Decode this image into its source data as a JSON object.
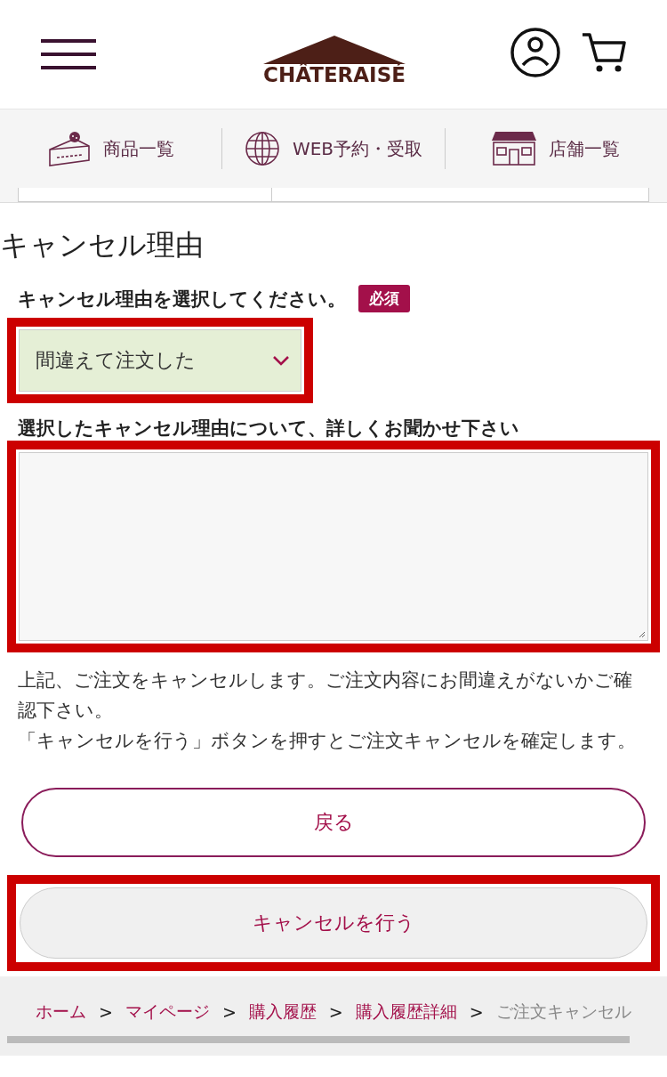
{
  "header": {
    "logo": "CHÂTERAISÉ"
  },
  "nav": [
    {
      "kind": "cake",
      "label": "商品一覧"
    },
    {
      "kind": "globe",
      "label": "WEB予約・受取"
    },
    {
      "kind": "store",
      "label": "店舗一覧"
    }
  ],
  "section_title": "キャンセル理由",
  "reason": {
    "label": "キャンセル理由を選択してください。",
    "badge": "必須",
    "value": "間違えて注文した",
    "highlighted": true
  },
  "details": {
    "label": "選択したキャンセル理由について、詳しくお聞かせ下さい",
    "highlighted": true
  },
  "notice": [
    "上記、ご注文をキャンセルします。ご注文内容にお間違えがないかご確認下さい。",
    "「キャンセルを行う」ボタンを押すとご注文キャンセルを確定します。"
  ],
  "buttons": [
    {
      "kind": "outline",
      "label": "戻る",
      "highlighted": false
    },
    {
      "kind": "filled",
      "label": "キャンセルを行う",
      "highlighted": true
    }
  ],
  "breadcrumb": [
    {
      "label": "ホーム",
      "current": false
    },
    {
      "label": "マイページ",
      "current": false
    },
    {
      "label": "購入履歴",
      "current": false
    },
    {
      "label": "購入履歴詳細",
      "current": false
    },
    {
      "label": "ご注文キャンセル",
      "current": true
    }
  ],
  "breadcrumb_separator": ">"
}
